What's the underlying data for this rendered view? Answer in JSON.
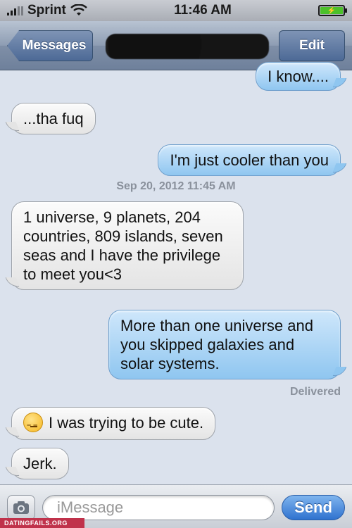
{
  "status_bar": {
    "carrier": "Sprint",
    "time": "11:46 AM"
  },
  "nav": {
    "back_label": "Messages",
    "edit_label": "Edit"
  },
  "messages": [
    {
      "id": "m1",
      "type": "sent",
      "text": "I know...."
    },
    {
      "id": "m2",
      "type": "received",
      "text": "...tha fuq"
    },
    {
      "id": "m3",
      "type": "sent",
      "text": "I'm just cooler than you"
    },
    {
      "id": "m4",
      "type": "received",
      "text": "1 universe, 9 planets, 204 countries, 809 islands, seven seas and I have the privilege  to meet you<3"
    },
    {
      "id": "m5",
      "type": "sent",
      "text": "More than one universe and you skipped galaxies and solar systems."
    },
    {
      "id": "m6",
      "type": "received",
      "text": "I was trying to be cute."
    },
    {
      "id": "m7",
      "type": "received",
      "text": "Jerk."
    }
  ],
  "timestamp": "Sep 20, 2012 11:45 AM",
  "delivered_label": "Delivered",
  "input": {
    "placeholder": "iMessage",
    "send_label": "Send"
  },
  "watermark": "DATINGFAILS.ORG",
  "colors": {
    "sent_bubble": "#8fc6f0",
    "received_bubble": "#e4e4e4",
    "send_button": "#2f72cf",
    "background": "#dbe2ed"
  }
}
